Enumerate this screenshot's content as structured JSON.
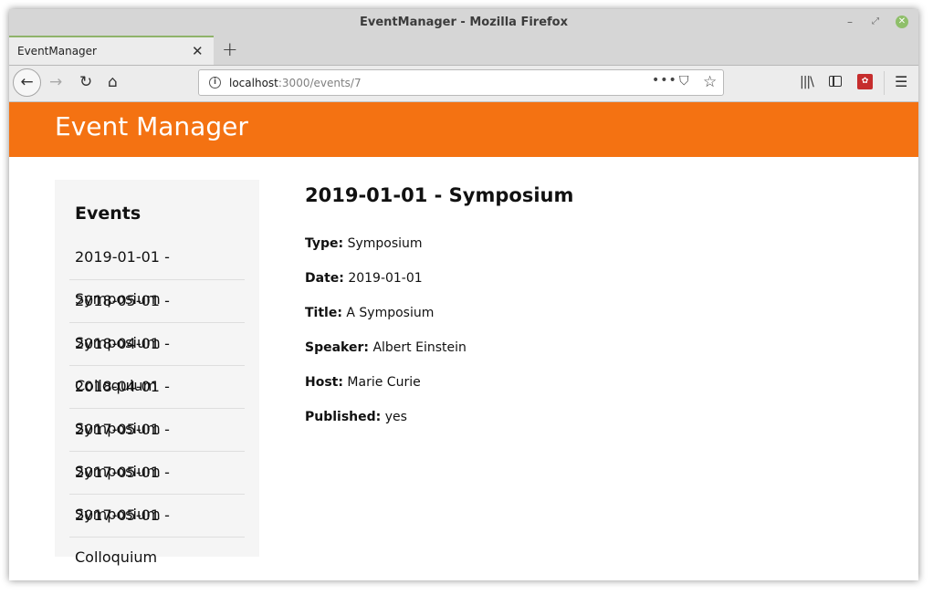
{
  "window": {
    "title": "EventManager - Mozilla Firefox",
    "minimize": "–",
    "maximize": "⤢",
    "close": "✕"
  },
  "tab": {
    "label": "EventManager",
    "close": "✕",
    "new_tab": "+"
  },
  "nav": {
    "back": "←",
    "forward": "→",
    "reload": "↻",
    "home": "⌂",
    "url_host": "localhost",
    "url_path": ":3000/events/7",
    "more": "•••",
    "pocket": "⛉",
    "star": "☆",
    "library": "|||\\",
    "menu": "☰",
    "info": "i"
  },
  "header": {
    "brand": "Event Manager"
  },
  "sidebar": {
    "heading": "Events",
    "items": [
      "2019-01-01 - Symposium",
      "2018-05-01 - Symposium",
      "2018-04-01 - Colloquium",
      "2018-04-01 - Symposium",
      "2017-05-01 - Symposium",
      "2017-05-01 - Symposium",
      "2017-05-01 - Colloquium"
    ]
  },
  "detail": {
    "heading": "2019-01-01 - Symposium",
    "fields": [
      {
        "label": "Type:",
        "value": "Symposium"
      },
      {
        "label": "Date:",
        "value": "2019-01-01"
      },
      {
        "label": "Title:",
        "value": "A Symposium"
      },
      {
        "label": "Speaker:",
        "value": "Albert Einstein"
      },
      {
        "label": "Host:",
        "value": "Marie Curie"
      },
      {
        "label": "Published:",
        "value": "yes"
      }
    ]
  },
  "colors": {
    "header": "#f47212",
    "sidebar_bg": "#f5f5f5"
  }
}
